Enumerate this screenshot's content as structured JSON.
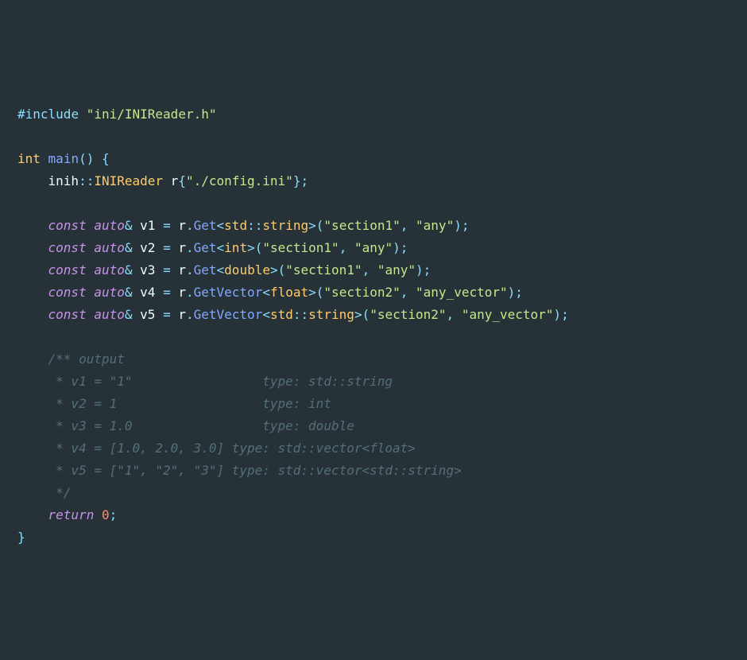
{
  "code": {
    "include_hash": "#",
    "include_kw": "include",
    "include_path": "\"ini/INIReader.h\"",
    "kw_int": "int",
    "fn_main": "main",
    "open_paren": "(",
    "close_paren": ")",
    "space": " ",
    "open_brace": "{",
    "close_brace": "}",
    "semicolon": ";",
    "dot": ".",
    "comma": ",",
    "amp": "&",
    "lt": "<",
    "gt": ">",
    "eq": "=",
    "dcolon": "::",
    "ns_inih": "inih",
    "ty_INIReader": "INIReader",
    "var_r": "r",
    "init_path": "\"./config.ini\"",
    "kw_const": "const",
    "kw_auto": "auto",
    "kw_return": "return",
    "v1": "v1",
    "v2": "v2",
    "v3": "v3",
    "v4": "v4",
    "v5": "v5",
    "m_Get": "Get",
    "m_GetVector": "GetVector",
    "ty_std": "std",
    "ty_string": "string",
    "ty_int": "int",
    "ty_double": "double",
    "ty_float": "float",
    "s_section1": "\"section1\"",
    "s_section2": "\"section2\"",
    "s_any": "\"any\"",
    "s_any_vector": "\"any_vector\"",
    "num_zero": "0",
    "c1": "/** output",
    "c2": " * v1 = \"1\"                 type: std::string",
    "c3": " * v2 = 1                   type: int",
    "c4": " * v3 = 1.0                 type: double",
    "c5": " * v4 = [1.0, 2.0, 3.0] type: std::vector<float>",
    "c6": " * v5 = [\"1\", \"2\", \"3\"] type: std::vector<std::string>",
    "c7": " */"
  }
}
